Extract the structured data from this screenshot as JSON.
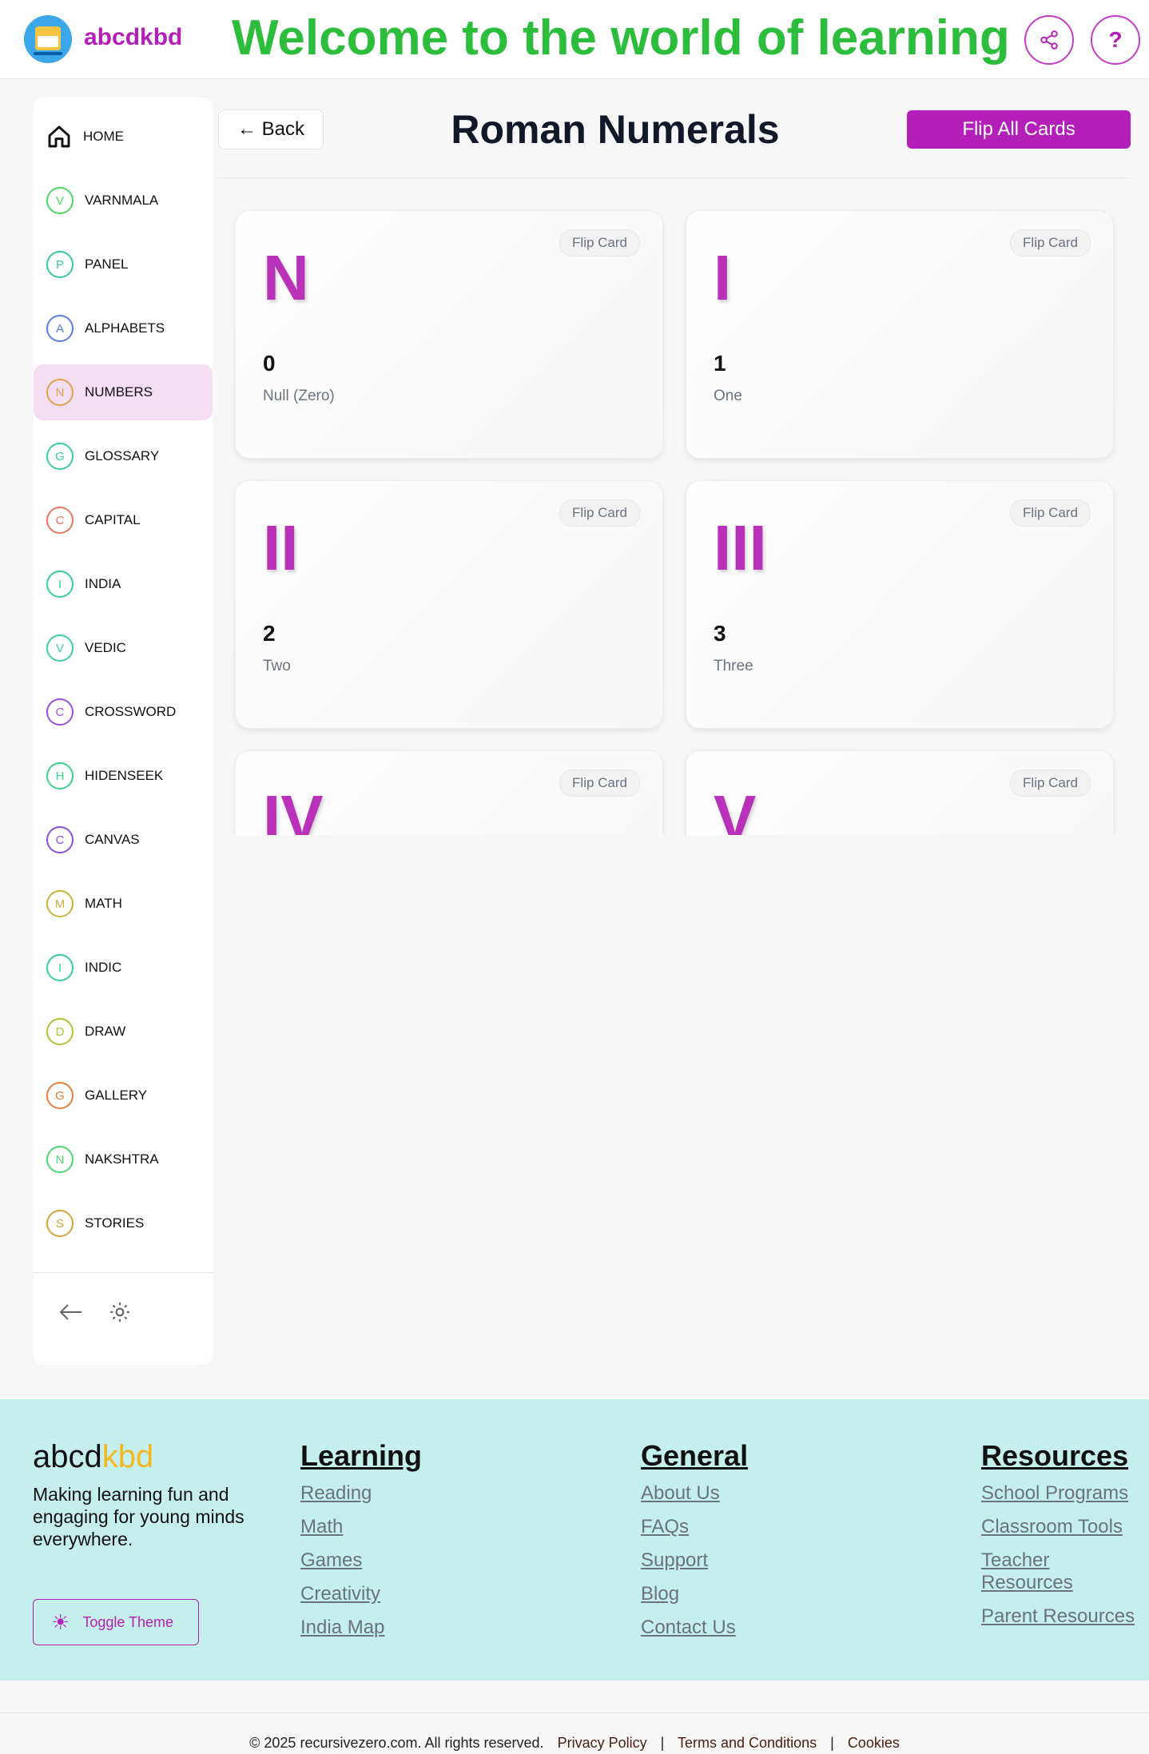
{
  "header": {
    "brand": "abcdkbd",
    "welcome": "Welcome to the world of learning",
    "help_label": "?"
  },
  "sidebar": {
    "items": [
      {
        "label": "HOME",
        "letter": "",
        "color": "#111111"
      },
      {
        "label": "VARNMALA",
        "letter": "V",
        "color": "#4cd964"
      },
      {
        "label": "PANEL",
        "letter": "P",
        "color": "#35c9a2"
      },
      {
        "label": "ALPHABETS",
        "letter": "A",
        "color": "#5b7fe0"
      },
      {
        "label": "NUMBERS",
        "letter": "N",
        "color": "#e3a34a"
      },
      {
        "label": "GLOSSARY",
        "letter": "G",
        "color": "#3dcf9a"
      },
      {
        "label": "CAPITAL",
        "letter": "C",
        "color": "#e87560"
      },
      {
        "label": "INDIA",
        "letter": "I",
        "color": "#35d0a0"
      },
      {
        "label": "VEDIC",
        "letter": "V",
        "color": "#3ecfa8"
      },
      {
        "label": "CROSSWORD",
        "letter": "C",
        "color": "#9a4fe0"
      },
      {
        "label": "HIDENSEEK",
        "letter": "H",
        "color": "#3bd48a"
      },
      {
        "label": "CANVAS",
        "letter": "C",
        "color": "#8a4fe0"
      },
      {
        "label": "MATH",
        "letter": "M",
        "color": "#c9b33a"
      },
      {
        "label": "INDIC",
        "letter": "I",
        "color": "#35cfa0"
      },
      {
        "label": "DRAW",
        "letter": "D",
        "color": "#b5c236"
      },
      {
        "label": "GALLERY",
        "letter": "G",
        "color": "#e4803c"
      },
      {
        "label": "NAKSHTRA",
        "letter": "N",
        "color": "#4bd872"
      },
      {
        "label": "STORIES",
        "letter": "S",
        "color": "#d2a63a"
      }
    ],
    "active_index": 4
  },
  "main": {
    "back_label": "← Back",
    "title": "Roman Numerals",
    "flip_all_label": "Flip All Cards",
    "flip_card_label": "Flip Card",
    "cards": [
      {
        "roman": "N",
        "number": "0",
        "word": "Null (Zero)"
      },
      {
        "roman": "I",
        "number": "1",
        "word": "One"
      },
      {
        "roman": "II",
        "number": "2",
        "word": "Two"
      },
      {
        "roman": "III",
        "number": "3",
        "word": "Three"
      },
      {
        "roman": "IV",
        "number": "",
        "word": ""
      },
      {
        "roman": "V",
        "number": "",
        "word": ""
      }
    ]
  },
  "footer": {
    "brand_a": "abcd",
    "brand_b": "kbd",
    "tagline": "Making learning fun and engaging for young minds everywhere.",
    "toggle_theme": "Toggle Theme",
    "columns": [
      {
        "title": "Learning",
        "links": [
          "Reading",
          "Math",
          "Games",
          "Creativity",
          "India Map"
        ]
      },
      {
        "title": "General",
        "links": [
          "About Us",
          "FAQs",
          "Support",
          "Blog",
          "Contact Us"
        ]
      },
      {
        "title": "Resources",
        "links": [
          "School Programs",
          "Classroom Tools",
          "Teacher Resources",
          "Parent Resources"
        ]
      }
    ],
    "copyright": "© 2025 recursivezero.com. All rights reserved.",
    "legal_links": [
      "Privacy Policy",
      "Terms and Conditions",
      "Cookies"
    ]
  }
}
